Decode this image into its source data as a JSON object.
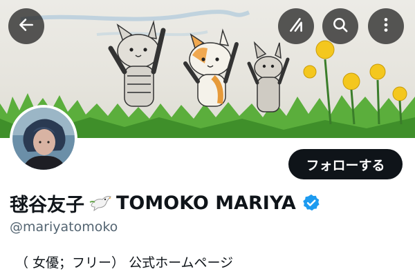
{
  "header": {
    "back_icon": "arrow-left-icon",
    "grok_icon": "grok-icon",
    "search_icon": "search-icon",
    "more_icon": "more-vertical-icon",
    "button_bg": "#222222"
  },
  "profile": {
    "name_ja": "毬谷友子",
    "name_en": "TOMOKO MARIYA",
    "handle": "@mariyatomoko",
    "bio": "（ 女優；フリー） 公式ホームページ",
    "follow_label": "フォローする",
    "verified_color": "#1d9bf0",
    "emoji_icon": "dove-of-peace-icon"
  },
  "colors": {
    "text": "#0f1419",
    "secondary_text": "#536471",
    "follow_bg": "#0f1419",
    "follow_text": "#ffffff"
  }
}
